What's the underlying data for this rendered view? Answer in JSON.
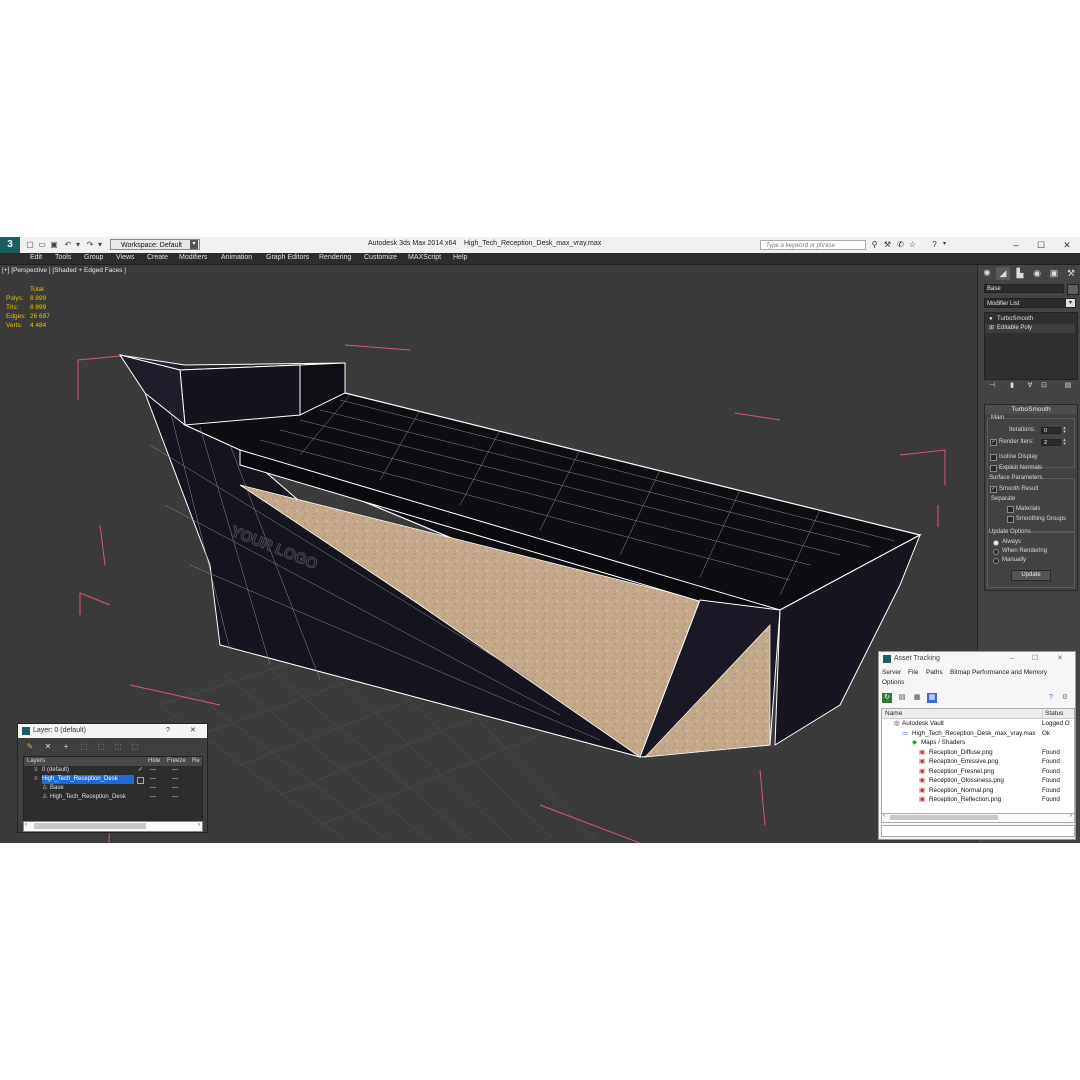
{
  "title_bar": {
    "workspace_label": "Workspace: Default",
    "app_name": "Autodesk 3ds Max  2014 x64",
    "file_name": "High_Tech_Reception_Desk_max_vray.max",
    "search_placeholder": "Type a keyword or phrase",
    "logo_icon": "3ds-max-logo-icon"
  },
  "menu": [
    "Edit",
    "Tools",
    "Group",
    "Views",
    "Create",
    "Modifiers",
    "Animation",
    "Graph Editors",
    "Rendering",
    "Customize",
    "MAXScript",
    "Help"
  ],
  "viewport": {
    "label": "[+] [Perspective ] [Shaded + Edged Faces ]",
    "stats": {
      "header": "Total",
      "rows": [
        {
          "key": "Polys:",
          "value": "8 899"
        },
        {
          "key": "Tris:",
          "value": "8 899"
        },
        {
          "key": "Edges:",
          "value": "26 697"
        },
        {
          "key": "Verts:",
          "value": "4 484"
        }
      ]
    },
    "logo_text": "YOUR LOGO",
    "colors": {
      "background": "#3b3b3b",
      "wire": "#ffffff",
      "face": "#15131f",
      "wood": "#c4a88a",
      "bbox": "#d65b6e"
    }
  },
  "command_panel": {
    "object_name": "Base",
    "modifier_list": "Modifier List",
    "stack": [
      "TurboSmooth",
      "Editable Poly"
    ],
    "turbosmooth": {
      "title": "TurboSmooth",
      "main": "Main",
      "iterations_label": "Iterations:",
      "iterations_value": "0",
      "render_iters_label": "Render Iters:",
      "render_iters_value": "2",
      "isoline": "Isoline Display",
      "explicit": "Explicit Normals",
      "surface_params": "Surface Parameters",
      "smooth_result": "Smooth Result",
      "separate": "Separate",
      "materials": "Materials",
      "smoothing_groups": "Smoothing Groups",
      "update_options": "Update Options",
      "always": "Always",
      "when_rendering": "When Rendering",
      "manually": "Manually",
      "update_button": "Update"
    }
  },
  "layer_window": {
    "title": "Layer: 0 (default)",
    "help": "?",
    "close": "✕",
    "columns": [
      "Layers",
      "Hide",
      "Freeze",
      "Re"
    ],
    "rows": [
      {
        "name": "0 (default)",
        "hide": "—",
        "freeze": "—",
        "indent": 0
      },
      {
        "name": "High_Tech_Reception_Desk",
        "hide": "—",
        "freeze": "—",
        "indent": 0
      },
      {
        "name": "Base",
        "hide": "—",
        "freeze": "—",
        "indent": 1
      },
      {
        "name": "High_Tech_Reception_Desk",
        "hide": "—",
        "freeze": "—",
        "indent": 1
      }
    ]
  },
  "asset_window": {
    "title": "Asset Tracking",
    "menu": [
      "Server",
      "File",
      "Paths",
      "Bitmap Performance and Memory",
      "Options"
    ],
    "columns": [
      "Name",
      "Status"
    ],
    "rows": [
      {
        "name": "Autodesk Vault",
        "status": "Logged O",
        "indent": 0
      },
      {
        "name": "High_Tech_Reception_Desk_max_vray.max",
        "status": "Ok",
        "indent": 1
      },
      {
        "name": "Maps / Shaders",
        "status": "",
        "indent": 2
      },
      {
        "name": "Reception_Diffuse.png",
        "status": "Found",
        "indent": 3
      },
      {
        "name": "Reception_Emissive.png",
        "status": "Found",
        "indent": 3
      },
      {
        "name": "Reception_Fresnel.png",
        "status": "Found",
        "indent": 3
      },
      {
        "name": "Reception_Glossiness.png",
        "status": "Found",
        "indent": 3
      },
      {
        "name": "Reception_Normal.png",
        "status": "Found",
        "indent": 3
      },
      {
        "name": "Reception_Reflection.png",
        "status": "Found",
        "indent": 3
      }
    ]
  }
}
